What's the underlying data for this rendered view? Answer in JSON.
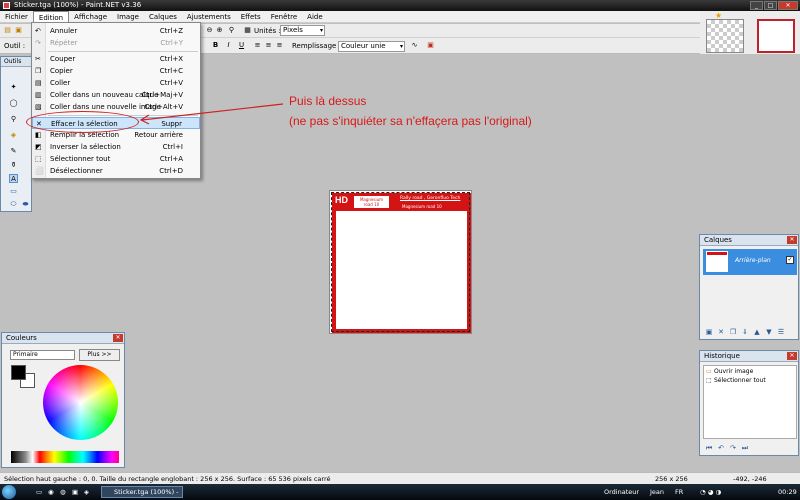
{
  "window": {
    "title": "Sticker.tga (100%) - Paint.NET v3.36"
  },
  "menubar": [
    "Fichier",
    "Edition",
    "Affichage",
    "Image",
    "Calques",
    "Ajustements",
    "Effets",
    "Fenêtre",
    "Aide"
  ],
  "toolbar": {
    "units_label": "Unités :",
    "units_value": "Pixels",
    "tool_label": "Outil :",
    "fill_label": "Remplissage :",
    "fill_value": "Couleur unie",
    "bold": "B",
    "italic": "I",
    "underline": "U"
  },
  "tools_panel": {
    "title": "Outils"
  },
  "edit_menu": {
    "items": [
      {
        "label": "Annuler",
        "shortcut": "Ctrl+Z",
        "icon": "undo-icon",
        "disabled": false
      },
      {
        "label": "Répéter",
        "shortcut": "Ctrl+Y",
        "icon": "redo-icon",
        "disabled": true
      },
      {
        "label": "Couper",
        "shortcut": "Ctrl+X",
        "icon": "cut-icon",
        "disabled": false
      },
      {
        "label": "Copier",
        "shortcut": "Ctrl+C",
        "icon": "copy-icon",
        "disabled": false
      },
      {
        "label": "Coller",
        "shortcut": "Ctrl+V",
        "icon": "paste-icon",
        "disabled": false
      },
      {
        "label": "Coller dans un nouveau calque",
        "shortcut": "Ctrl+Maj+V",
        "icon": "paste-layer-icon",
        "disabled": false
      },
      {
        "label": "Coller dans une nouvelle image",
        "shortcut": "Ctrl+Alt+V",
        "icon": "paste-image-icon",
        "disabled": false
      },
      {
        "label": "Effacer la sélection",
        "shortcut": "Suppr",
        "icon": "erase-selection-icon",
        "disabled": false,
        "highlighted": true
      },
      {
        "label": "Remplir la sélection",
        "shortcut": "Retour arrière",
        "icon": "fill-selection-icon",
        "disabled": false
      },
      {
        "label": "Inverser la sélection",
        "shortcut": "Ctrl+I",
        "icon": "invert-selection-icon",
        "disabled": false
      },
      {
        "label": "Sélectionner tout",
        "shortcut": "Ctrl+A",
        "icon": "select-all-icon",
        "disabled": false
      },
      {
        "label": "Désélectionner",
        "shortcut": "Ctrl+D",
        "icon": "deselect-icon",
        "disabled": false
      }
    ]
  },
  "annotation": {
    "line1": "Puis là dessus",
    "line2": "(ne pas s'inquiéter sa n'effaçera pas l'original)",
    "color": "#d81818"
  },
  "sticker": {
    "hd": "HD",
    "box_line1": "Magnesium",
    "box_line2": "road 10",
    "text1": "Rally road , Geronfluo Tech",
    "text2": "Magnesium road 10",
    "color": "#d41414"
  },
  "couleurs": {
    "title": "Couleurs",
    "mode": "Primaire",
    "more_button": "Plus >>"
  },
  "calques": {
    "title": "Calques",
    "layers": [
      {
        "name": "Arrière-plan",
        "visible": true
      }
    ]
  },
  "historique": {
    "title": "Historique",
    "items": [
      "Ouvrir image",
      "Sélectionner tout"
    ]
  },
  "statusbar": {
    "text": "Sélection haut gauche : 0, 0. Taille du rectangle englobant : 256 x 256. Surface : 65 536 pixels carré",
    "size": "256 x 256",
    "coords": "-492, -246"
  },
  "taskbar": {
    "task": "Sticker.tga (100%) - ...",
    "computer": "Ordinateur",
    "user": "Jean",
    "lang": "FR",
    "time": "00:29"
  }
}
